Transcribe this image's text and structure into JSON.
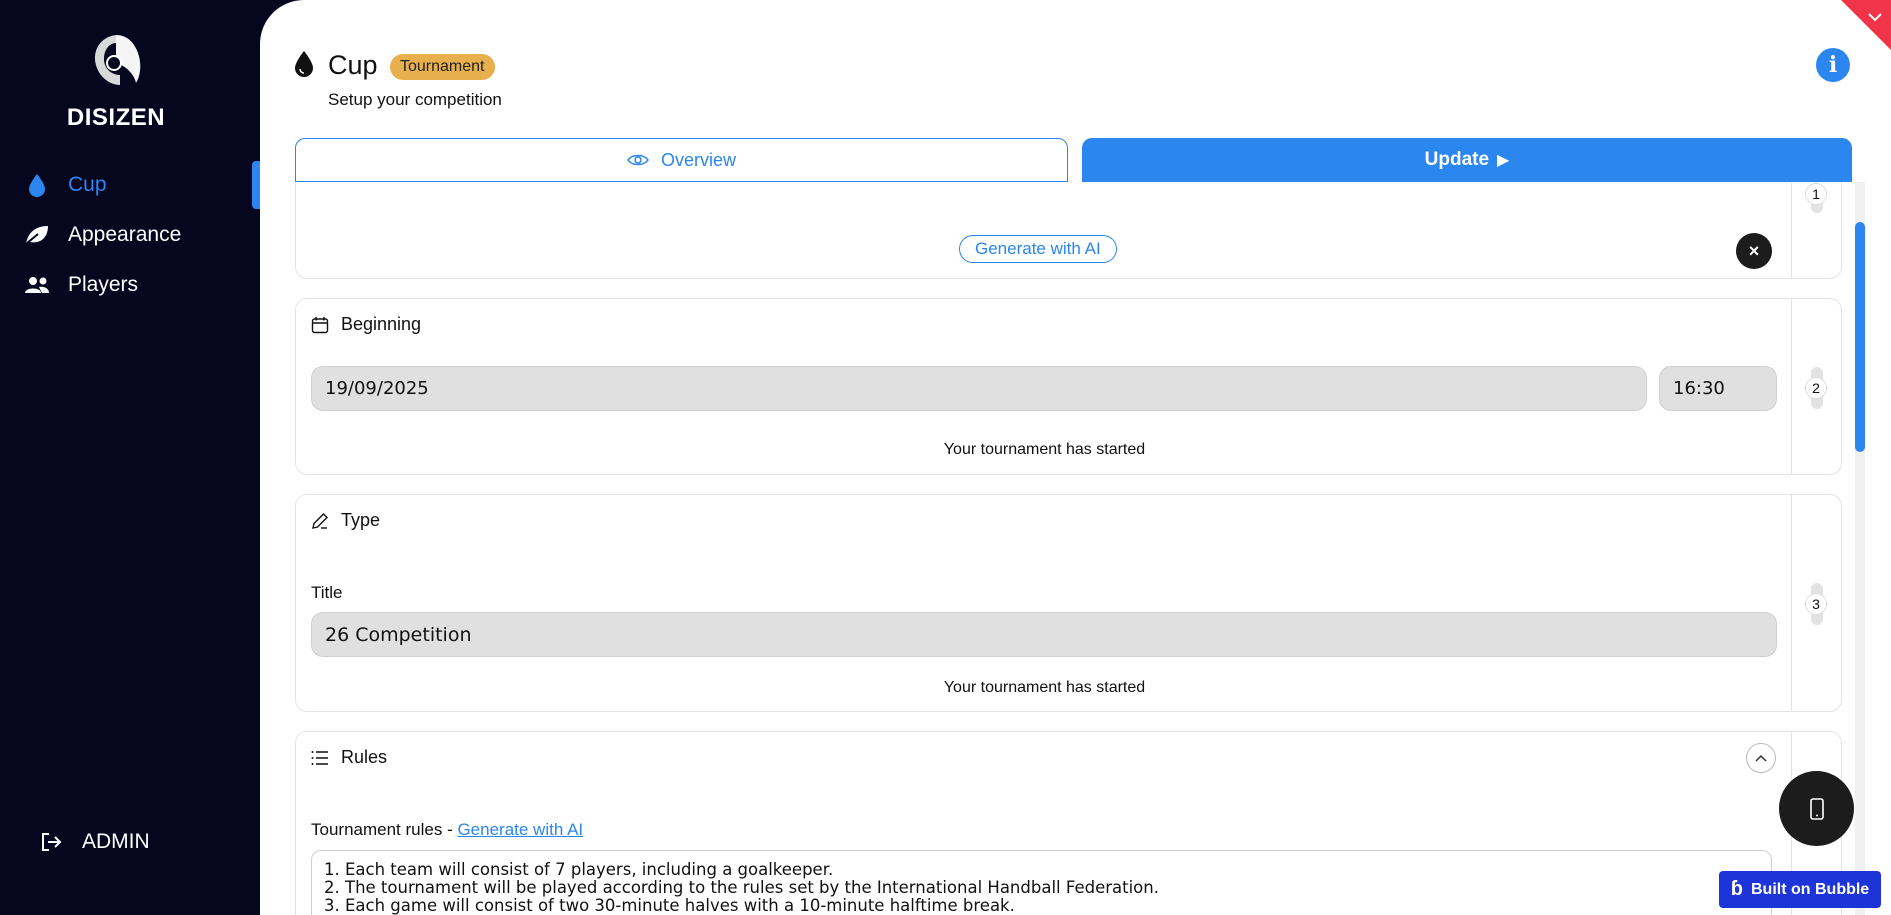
{
  "sidebar": {
    "brand": "DISIZEN",
    "items": [
      {
        "label": "Cup",
        "icon": "drop-icon"
      },
      {
        "label": "Appearance",
        "icon": "leaf-icon"
      },
      {
        "label": "Players",
        "icon": "users-icon"
      }
    ],
    "admin_label": "ADMIN"
  },
  "header": {
    "title": "Cup",
    "badge": "Tournament",
    "subtitle": "Setup your competition",
    "info_icon": "i"
  },
  "tabs": {
    "overview": "Overview",
    "update": "Update"
  },
  "cards": {
    "ai_section": {
      "step": "1",
      "ai_button": "Generate with AI",
      "close_icon": "×"
    },
    "beginning": {
      "step": "2",
      "title": "Beginning",
      "date": "19/09/2025",
      "time": "16:30",
      "note": "Your tournament has started"
    },
    "type": {
      "step": "3",
      "title": "Type",
      "field_label": "Title",
      "field_value": "26 Competition",
      "note": "Your tournament has started"
    },
    "rules": {
      "title": "Rules",
      "label_prefix": "Tournament rules - ",
      "label_link": "Generate with AI",
      "lines": [
        "1. Each team will consist of 7 players, including a goalkeeper.",
        "2. The tournament will be played according to the rules set by the International Handball Federation.",
        "3. Each game will consist of two 30-minute halves with a 10-minute halftime break."
      ]
    }
  },
  "footer": {
    "bubble_badge": "Built on Bubble"
  },
  "colors": {
    "accent": "#2b86f0",
    "sidebar_bg": "#06061f",
    "badge": "#e8b04d",
    "bubble": "#1d35d8"
  }
}
